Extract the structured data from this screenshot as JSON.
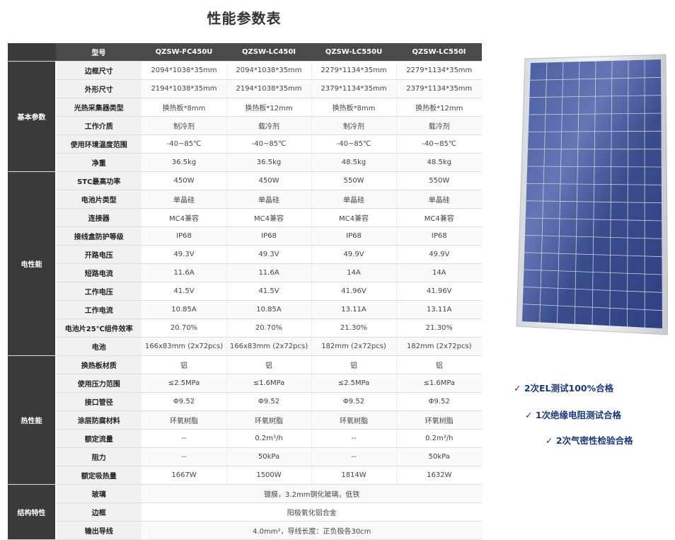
{
  "title": "性能参数表",
  "header": {
    "row_label": "型号",
    "models": [
      "QZSW-FC450U",
      "QZSW-LC450I",
      "QZSW-LC550U",
      "QZSW-LC550I"
    ]
  },
  "groups": [
    {
      "name": "基本参数",
      "rows": [
        {
          "label": "边框尺寸",
          "values": [
            "2094*1038*35mm",
            "2094*1038*35mm",
            "2279*1134*35mm",
            "2279*1134*35mm"
          ]
        },
        {
          "label": "外形尺寸",
          "values": [
            "2194*1038*35mm",
            "2194*1038*35mm",
            "2379*1134*35mm",
            "2379*1134*35mm"
          ]
        },
        {
          "label": "光热采集器类型",
          "values": [
            "换热板*8mm",
            "换热板*12mm",
            "换热板*8mm",
            "换热板*12mm"
          ]
        },
        {
          "label": "工作介质",
          "values": [
            "制冷剂",
            "载冷剂",
            "制冷剂",
            "载冷剂"
          ]
        },
        {
          "label": "使用环境温度范围",
          "values": [
            "-40~85℃",
            "-40~85℃",
            "-40~85℃",
            "-40~85℃"
          ]
        },
        {
          "label": "净重",
          "values": [
            "36.5kg",
            "36.5kg",
            "48.5kg",
            "48.5kg"
          ]
        }
      ]
    },
    {
      "name": "电性能",
      "rows": [
        {
          "label": "STC最高功率",
          "values": [
            "450W",
            "450W",
            "550W",
            "550W"
          ]
        },
        {
          "label": "电池片类型",
          "values": [
            "单晶硅",
            "单晶硅",
            "单晶硅",
            "单晶硅"
          ]
        },
        {
          "label": "连接器",
          "values": [
            "MC4兼容",
            "MC4兼容",
            "MC4兼容",
            "MC4兼容"
          ]
        },
        {
          "label": "接线盒防护等级",
          "values": [
            "IP68",
            "IP68",
            "IP68",
            "IP68"
          ]
        },
        {
          "label": "开路电压",
          "values": [
            "49.3V",
            "49.3V",
            "49.9V",
            "49.9V"
          ]
        },
        {
          "label": "短路电流",
          "values": [
            "11.6A",
            "11.6A",
            "14A",
            "14A"
          ]
        },
        {
          "label": "工作电压",
          "values": [
            "41.5V",
            "41.5V",
            "41.96V",
            "41.96V"
          ]
        },
        {
          "label": "工作电流",
          "values": [
            "10.85A",
            "10.85A",
            "13.11A",
            "13.11A"
          ]
        },
        {
          "label": "电池片25℃组件效率",
          "values": [
            "20.70%",
            "20.70%",
            "21.30%",
            "21.30%"
          ]
        },
        {
          "label": "电池",
          "values": [
            "166x83mm (2x72pcs)",
            "166x83mm (2x72pcs)",
            "182mm (2x72pcs)",
            "182mm (2x72pcs)"
          ]
        }
      ]
    },
    {
      "name": "热性能",
      "rows": [
        {
          "label": "换热板材质",
          "values": [
            "铝",
            "铝",
            "铝",
            "铝"
          ]
        },
        {
          "label": "使用压力范围",
          "values": [
            "≤2.5MPa",
            "≤1.6MPa",
            "≤2.5MPa",
            "≤1.6MPa"
          ]
        },
        {
          "label": "接口管径",
          "values": [
            "Φ9.52",
            "Φ9.52",
            "Φ9.52",
            "Φ9.52"
          ]
        },
        {
          "label": "涂层防腐材料",
          "values": [
            "环氧树脂",
            "环氧树脂",
            "环氧树脂",
            "环氧树脂"
          ]
        },
        {
          "label": "额定流量",
          "values": [
            "--",
            "0.2m³/h",
            "--",
            "0.2m³/h"
          ]
        },
        {
          "label": "阻力",
          "values": [
            "--",
            "50kPa",
            "--",
            "50kPa"
          ]
        },
        {
          "label": "额定吸热量",
          "values": [
            "1667W",
            "1500W",
            "1814W",
            "1632W"
          ]
        }
      ]
    },
    {
      "name": "结构特性",
      "rows": [
        {
          "label": "玻璃",
          "span_value": "镀膜，3.2mm钢化玻璃，低铁"
        },
        {
          "label": "边框",
          "span_value": "阳极氧化铝合金"
        },
        {
          "label": "输出导线",
          "span_value": "4.0mm²，导线长度：正负极各30cm"
        }
      ]
    }
  ],
  "checks": [
    "✓ 2次EL测试100%合格",
    "✓ 1次绝缘电阻测试合格",
    "✓ 2次气密性检验合格"
  ],
  "panel": {
    "frame_color": "#e6e9ec",
    "cell_color": "#3d4f8e",
    "grid_color": "#c9d0e2"
  }
}
